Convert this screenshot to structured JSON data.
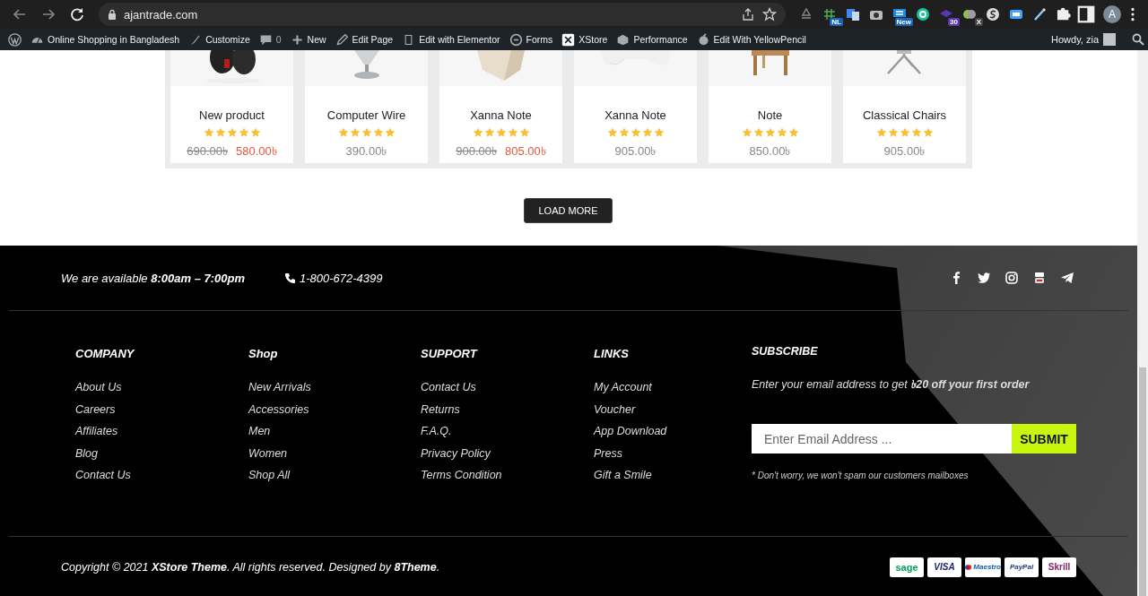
{
  "browser": {
    "url": "ajantrade.com",
    "extensions": [
      {
        "kind": "recycle"
      },
      {
        "kind": "grid",
        "badge": "NL"
      },
      {
        "kind": "translate"
      },
      {
        "kind": "camera"
      },
      {
        "kind": "screen",
        "badge": "New"
      },
      {
        "kind": "grammar"
      },
      {
        "kind": "cap",
        "badge": "30"
      },
      {
        "kind": "layers",
        "badge": "X"
      },
      {
        "kind": "s-circle"
      },
      {
        "kind": "capture"
      },
      {
        "kind": "dropper"
      }
    ],
    "avatar": "A"
  },
  "admin_bar": {
    "items": [
      {
        "kind": "wordpress"
      },
      {
        "kind": "dashboard",
        "label": "Online Shopping in Bangladesh"
      },
      {
        "kind": "brush",
        "label": "Customize"
      },
      {
        "kind": "comment",
        "label": "0"
      },
      {
        "kind": "plus",
        "label": "New"
      },
      {
        "kind": "pencil",
        "label": "Edit Page"
      },
      {
        "kind": "page",
        "label": "Edit with Elementor"
      },
      {
        "kind": "forms",
        "label": "Forms"
      },
      {
        "kind": "xstore",
        "label": "XStore"
      },
      {
        "kind": "box",
        "label": "Performance"
      },
      {
        "kind": "drop",
        "label": "Edit With YellowPencil"
      }
    ],
    "greeting": "Howdy, zia"
  },
  "products": [
    {
      "title": "New product",
      "stars": 5,
      "old_price": "690.00৳",
      "price": "580.00৳"
    },
    {
      "title": "Computer Wire",
      "stars": 5,
      "price": "390.00৳"
    },
    {
      "title": "Xanna Note",
      "stars": 5,
      "old_price": "900.00৳",
      "price": "805.00৳"
    },
    {
      "title": "Xanna Note",
      "stars": 5,
      "price": "905.00৳"
    },
    {
      "title": "Note",
      "stars": 5,
      "price": "850.00৳"
    },
    {
      "title": "Classical Chairs",
      "stars": 5,
      "price": "905.00৳"
    }
  ],
  "load_more": "LOAD MORE",
  "footer": {
    "availability": "We are available **8:00am – 7:00pm**",
    "phone": "1-800-672-4399",
    "socials": [
      {
        "kind": "facebook"
      },
      {
        "kind": "twitter"
      },
      {
        "kind": "instagram"
      },
      {
        "kind": "youtube"
      },
      {
        "kind": "telegram"
      }
    ],
    "columns": [
      {
        "heading": "COMPANY",
        "links": [
          "About Us",
          "Careers",
          "Affiliates",
          "Blog",
          "Contact Us"
        ]
      },
      {
        "heading": "Shop",
        "links": [
          "New Arrivals",
          "Accessories",
          "Men",
          "Women",
          "Shop All"
        ]
      },
      {
        "heading": "SUPPORT",
        "links": [
          "Contact Us",
          "Returns",
          "F.A.Q.",
          "Privacy Policy",
          "Terms Condition"
        ]
      },
      {
        "heading": "LINKS",
        "links": [
          "My Account",
          "Voucher",
          "App Download",
          "Press",
          "Gift a Smile"
        ]
      }
    ],
    "subscribe": {
      "heading": "SUBSCRIBE",
      "text": "Enter your email address to get **৳20 off your first order**",
      "placeholder": "Enter Email Address ...",
      "button": "SUBMIT",
      "note": "* Don't worry, we won't spam our customers mailboxes"
    },
    "copyright": "Copyright © 2021 **XStore Theme**. All rights reserved. Designed by **8Theme**.",
    "payments": [
      {
        "kind": "sage",
        "label": "sage"
      },
      {
        "kind": "visa",
        "label": "VISA"
      },
      {
        "kind": "maestro",
        "label": "Maestro"
      },
      {
        "kind": "paypal",
        "label": "PayPal"
      },
      {
        "kind": "skrill",
        "label": "Skrill"
      }
    ]
  }
}
